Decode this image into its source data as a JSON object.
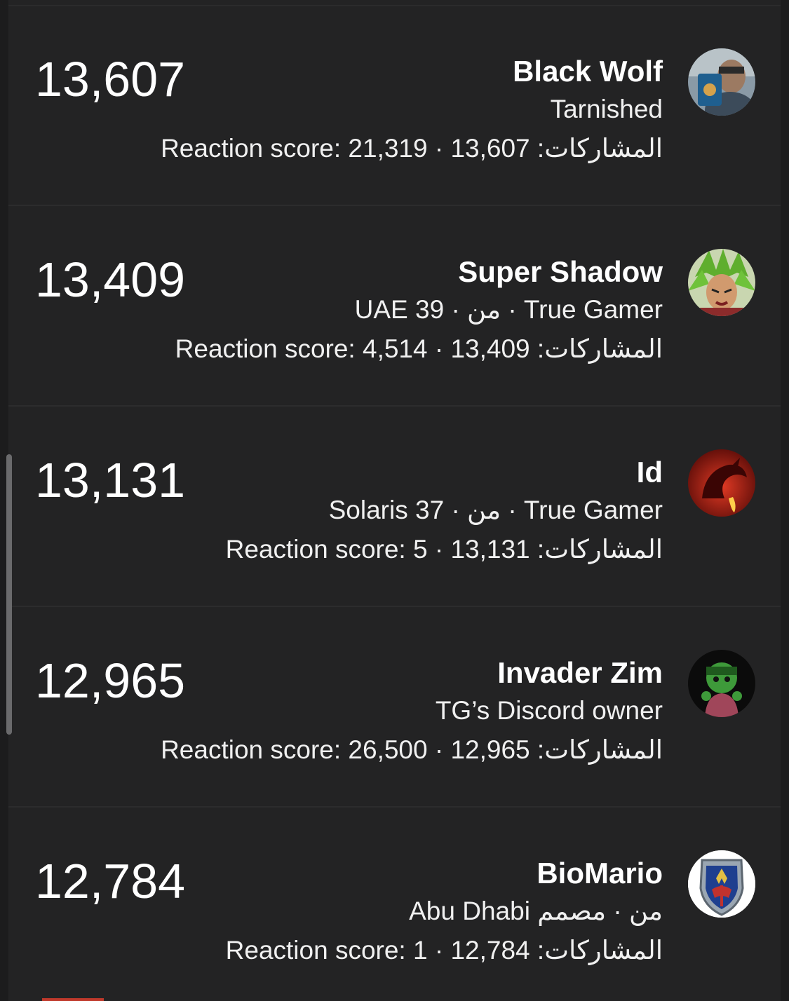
{
  "members": [
    {
      "count": "13,607",
      "name": "Black Wolf",
      "subtitle": "Tarnished",
      "stats": "Reaction score: 21,319 · 13,607 :المشاركات",
      "avatar_icon": "person-with-game-avatar"
    },
    {
      "count": "13,409",
      "name": "Super Shadow",
      "subtitle": "UAE من · 39 · True Gamer",
      "stats": "Reaction score: 4,514 · 13,409 :المشاركات",
      "avatar_icon": "anime-warrior-avatar"
    },
    {
      "count": "13,131",
      "name": "Id",
      "subtitle": "Solaris من · 37 · True Gamer",
      "stats": "Reaction score: 5 · 13,131 :المشاركات",
      "avatar_icon": "red-dragon-avatar"
    },
    {
      "count": "12,965",
      "name": "Invader Zim",
      "subtitle": "TG’s Discord owner",
      "stats": "Reaction score: 26,500 · 12,965 :المشاركات",
      "avatar_icon": "green-character-avatar"
    },
    {
      "count": "12,784",
      "name": "BioMario",
      "subtitle": "Abu Dhabi من · مصمم",
      "stats": "Reaction score: 1 · 12,784 :المشاركات",
      "avatar_icon": "hylian-shield-avatar"
    }
  ],
  "colors": {
    "background": "#1c1c1d",
    "list_background": "#232324",
    "divider": "#2c2c2d",
    "text": "#ffffff",
    "accent_tab": "#c0392b"
  }
}
